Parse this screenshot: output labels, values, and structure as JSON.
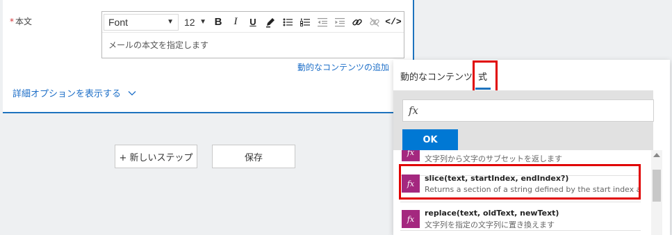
{
  "field": {
    "required_mark": "*",
    "label": "本文"
  },
  "toolbar": {
    "font": "Font",
    "size": "12",
    "bold": "B",
    "italic": "I",
    "underline": "U",
    "code": "</>"
  },
  "editor": {
    "placeholder": "メールの本文を指定します"
  },
  "links": {
    "dynamic_content": "動的なコンテンツの追加",
    "advanced_options": "詳細オプションを表示する"
  },
  "steps": {
    "new_step": "+ 新しいステップ",
    "save": "保存"
  },
  "popup": {
    "tabs": [
      {
        "label": "動的なコンテンツ"
      },
      {
        "label": "式"
      }
    ],
    "active_tab": "式",
    "fx_symbol": "fx",
    "ok_label": "OK",
    "functions": [
      {
        "name": "",
        "desc": "文字列から文字のサブセットを返します"
      },
      {
        "name": "slice(text, startIndex, endIndex?)",
        "desc": "Returns a section of a string defined by the start index an..."
      },
      {
        "name": "replace(text, oldText, newText)",
        "desc": "文字列を指定の文字列に置き換えます"
      }
    ]
  },
  "colors": {
    "accent": "#0078d4",
    "function_icon": "#a4287f",
    "highlight": "#e00000",
    "link": "#1e6fc8"
  }
}
